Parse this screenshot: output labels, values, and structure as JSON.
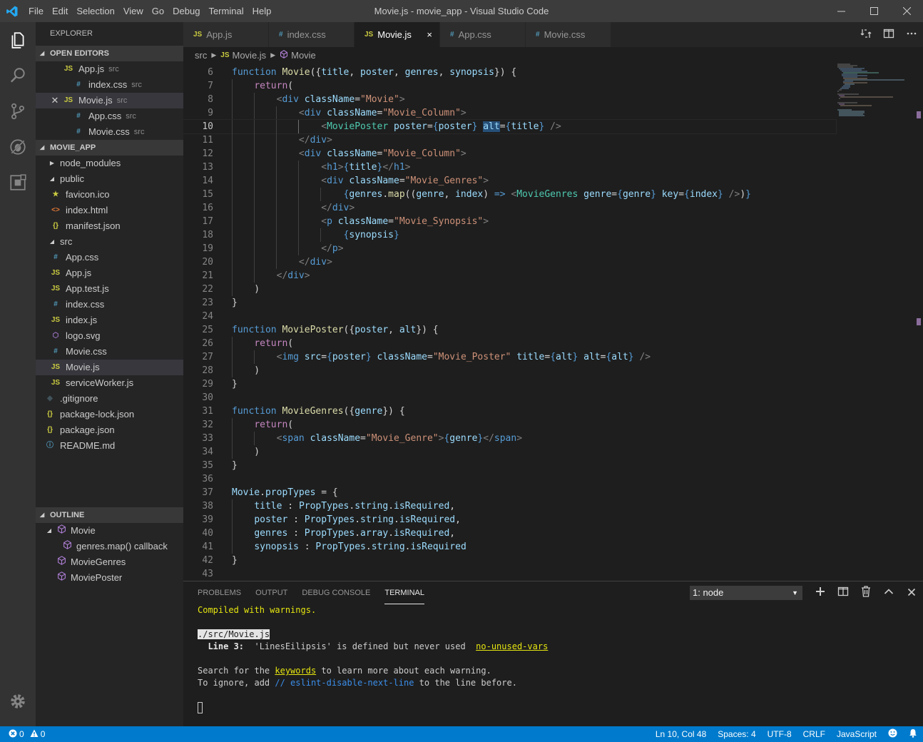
{
  "window": {
    "title": "Movie.js - movie_app - Visual Studio Code",
    "menu": [
      "File",
      "Edit",
      "Selection",
      "View",
      "Go",
      "Debug",
      "Terminal",
      "Help"
    ]
  },
  "sidebar": {
    "title": "EXPLORER",
    "open_editors": {
      "header": "OPEN EDITORS",
      "items": [
        {
          "icon": "JS",
          "name": "App.js",
          "dir": "src"
        },
        {
          "icon": "#",
          "name": "index.css",
          "dir": "src"
        },
        {
          "icon": "JS",
          "name": "Movie.js",
          "dir": "src"
        },
        {
          "icon": "#",
          "name": "App.css",
          "dir": "src"
        },
        {
          "icon": "#",
          "name": "Movie.css",
          "dir": "src"
        }
      ]
    },
    "project": {
      "header": "MOVIE_APP",
      "items": [
        {
          "name": "node_modules"
        },
        {
          "name": "public"
        },
        {
          "icon": "★",
          "name": "favicon.ico"
        },
        {
          "icon": "<>",
          "name": "index.html"
        },
        {
          "icon": "{}",
          "name": "manifest.json"
        },
        {
          "name": "src"
        },
        {
          "icon": "#",
          "name": "App.css"
        },
        {
          "icon": "JS",
          "name": "App.js"
        },
        {
          "icon": "JS",
          "name": "App.test.js"
        },
        {
          "icon": "#",
          "name": "index.css"
        },
        {
          "icon": "JS",
          "name": "index.js"
        },
        {
          "icon": "⬡",
          "name": "logo.svg"
        },
        {
          "icon": "#",
          "name": "Movie.css"
        },
        {
          "icon": "JS",
          "name": "Movie.js"
        },
        {
          "icon": "JS",
          "name": "serviceWorker.js"
        },
        {
          "icon": "◆",
          "name": ".gitignore"
        },
        {
          "icon": "{}",
          "name": "package-lock.json"
        },
        {
          "icon": "{}",
          "name": "package.json"
        },
        {
          "icon": "ⓘ",
          "name": "README.md"
        }
      ]
    },
    "outline": {
      "header": "OUTLINE",
      "items": [
        {
          "name": "Movie"
        },
        {
          "name": "genres.map() callback"
        },
        {
          "name": "MovieGenres"
        },
        {
          "name": "MoviePoster"
        }
      ]
    }
  },
  "tabs": [
    {
      "icon": "JS",
      "label": "App.js"
    },
    {
      "icon": "#",
      "label": "index.css"
    },
    {
      "icon": "JS",
      "label": "Movie.js",
      "close": "×"
    },
    {
      "icon": "#",
      "label": "App.css"
    },
    {
      "icon": "#",
      "label": "Movie.css"
    }
  ],
  "breadcrumb": {
    "folder": "src",
    "file_icon": "JS",
    "file": "Movie.js",
    "symbol": "Movie"
  },
  "code": {
    "line_numbers": [
      "6",
      "7",
      "8",
      "9",
      "10",
      "11",
      "12",
      "13",
      "14",
      "15",
      "16",
      "17",
      "18",
      "19",
      "20",
      "21",
      "22",
      "23",
      "24",
      "25",
      "26",
      "27",
      "28",
      "29",
      "30",
      "31",
      "32",
      "33",
      "34",
      "35",
      "36",
      "37",
      "38",
      "39",
      "40",
      "41",
      "42",
      "43"
    ]
  },
  "panel": {
    "tabs": [
      "PROBLEMS",
      "OUTPUT",
      "DEBUG CONSOLE",
      "TERMINAL"
    ],
    "terminal_select": "1: node",
    "terminal": {
      "compiled": "Compiled with warnings.",
      "file": "./src/Movie.js",
      "line_label": "Line 3:",
      "warning_msg": "'LinesEilipsis' is defined but never used",
      "rule": "no-unused-vars",
      "search_pre": "Search for the ",
      "keywords": "keywords",
      "search_post": " to learn more about each warning.",
      "ignore_pre": "To ignore, add ",
      "ignore_comment": "// eslint-disable-next-line",
      "ignore_post": " to the line before."
    }
  },
  "status": {
    "errors": "0",
    "warnings": "0",
    "position": "Ln 10, Col 48",
    "spaces": "Spaces: 4",
    "encoding": "UTF-8",
    "eol": "CRLF",
    "language": "JavaScript"
  },
  "colors": {
    "accent": "#007acc",
    "activity_bar": "#333333",
    "sidebar": "#252526",
    "editor": "#1e1e1e"
  }
}
